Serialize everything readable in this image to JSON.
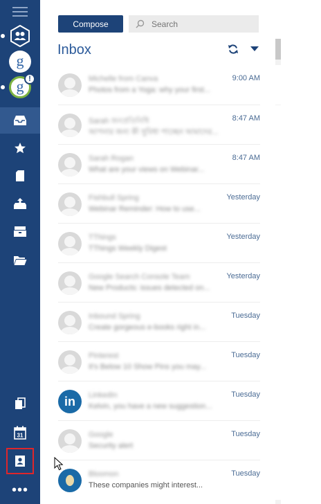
{
  "compose_label": "Compose",
  "search": {
    "placeholder": "Search"
  },
  "folder_title": "Inbox",
  "accounts": [
    {
      "name": "accounts-group",
      "letter": ""
    },
    {
      "name": "google-account",
      "letter": "g"
    },
    {
      "name": "google-account-alert",
      "letter": "g",
      "badge": "!"
    }
  ],
  "emails": [
    {
      "sender": "Michelle from Canva",
      "subject": "Photos from a Yoga: why your first...",
      "time": "9:00 AM",
      "avatar": "blank"
    },
    {
      "sender": "Sarah জনপ্রতিনিধি",
      "subject": "আপনার জন্য কী সুবিধা পাচ্ছেন আমাদের...",
      "time": "8:47 AM",
      "avatar": "blank"
    },
    {
      "sender": "Sarah Rogan",
      "subject": "What are your views on Webinar...",
      "time": "8:47 AM",
      "avatar": "blank"
    },
    {
      "sender": "Fishbull Spring",
      "subject": "Webinar Reminder: How to use...",
      "time": "Yesterday",
      "avatar": "blank"
    },
    {
      "sender": "TThings",
      "subject": "TThings Weekly Digest",
      "time": "Yesterday",
      "avatar": "blank"
    },
    {
      "sender": "Google Search Console Team",
      "subject": "New Products: issues detected on...",
      "time": "Yesterday",
      "avatar": "blank"
    },
    {
      "sender": "Inbound Spring",
      "subject": "Create gorgeous e-books right in...",
      "time": "Tuesday",
      "avatar": "blank"
    },
    {
      "sender": "Pinterest",
      "subject": "It's Below 10 Show Pins you may...",
      "time": "Tuesday",
      "avatar": "blank"
    },
    {
      "sender": "LinkedIn",
      "subject": "Kelvin, you have a new suggestion...",
      "time": "Tuesday",
      "avatar": "li"
    },
    {
      "sender": "Google",
      "subject": "Security alert",
      "time": "Tuesday",
      "avatar": "blank"
    },
    {
      "sender": "Bloomon",
      "subject": "These companies might interest...",
      "time": "Tuesday",
      "avatar": "lb",
      "clear_subject": true
    }
  ],
  "colors": {
    "sidebar": "#1d4378",
    "accent": "#2b5a9a",
    "highlight": "#e0262a"
  }
}
